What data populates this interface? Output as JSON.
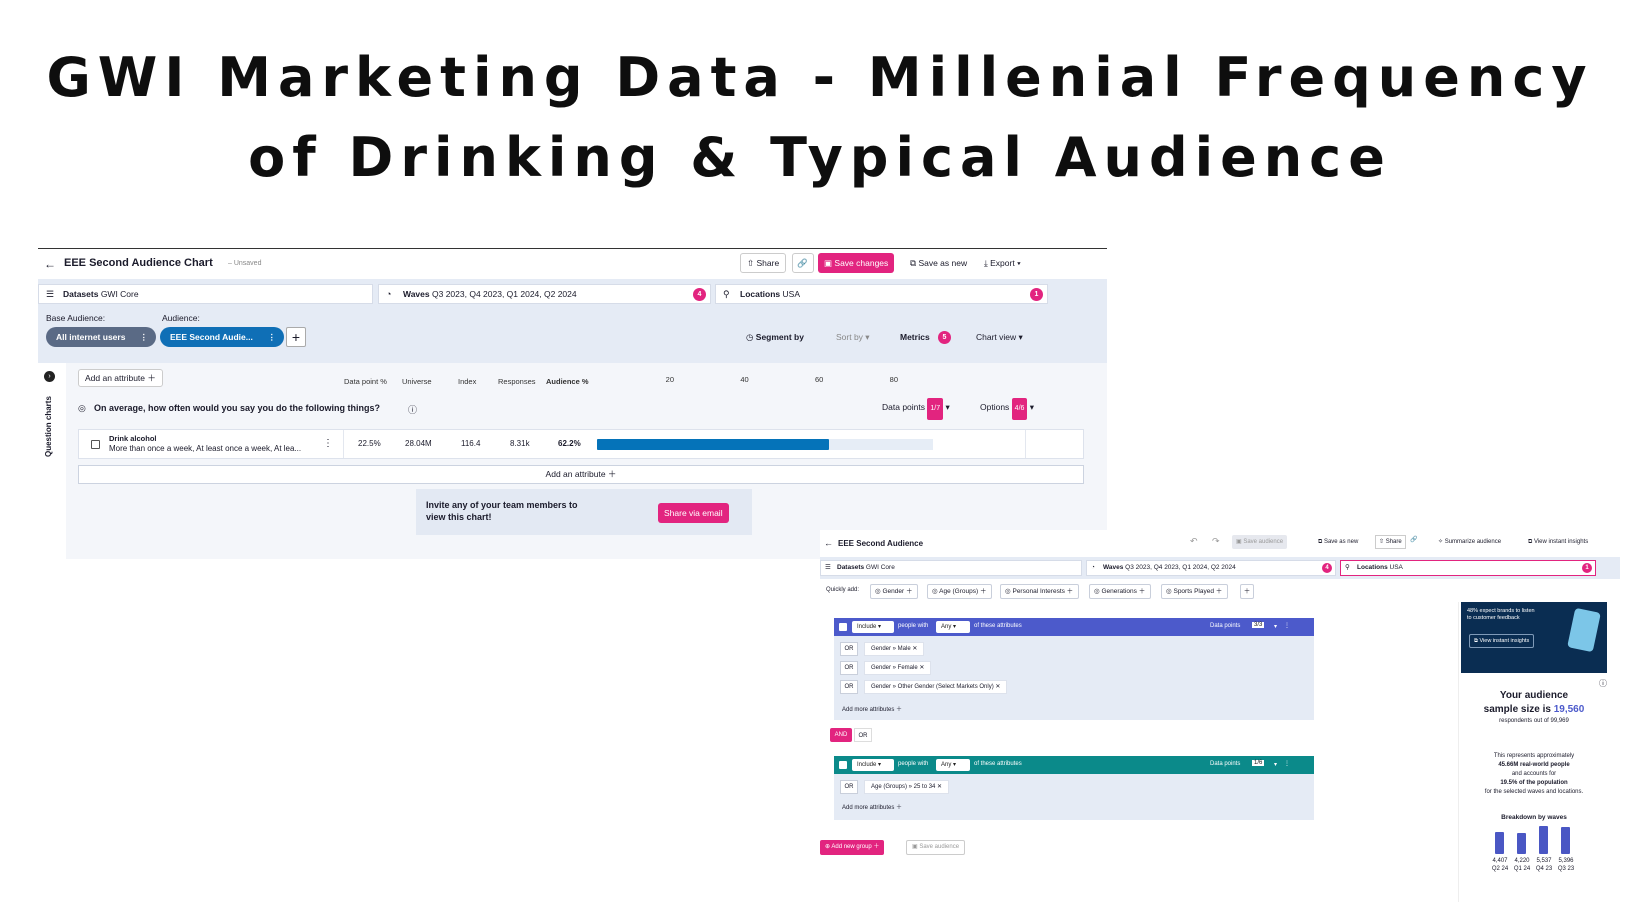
{
  "title_line1": "GWI Marketing Data - Millenial Frequency",
  "title_line2": "of Drinking & Typical Audience",
  "shot1": {
    "chart_title": "EEE Second Audience Chart",
    "unsaved": "– Unsaved",
    "share": "Share",
    "save_changes": "Save changes",
    "save_as_new": "Save as new",
    "export": "Export",
    "datasets_label": "Datasets",
    "datasets_value": "GWI Core",
    "waves_label": "Waves",
    "waves_value": "Q3 2023, Q4 2023, Q1 2024, Q2 2024",
    "waves_count": "4",
    "locations_label": "Locations",
    "locations_value": "USA",
    "locations_count": "1",
    "base_audience_label": "Base Audience:",
    "audience_label": "Audience:",
    "base_pill": "All internet users",
    "audience_pill": "EEE Second Audie...",
    "segment_by": "Segment by",
    "sort_by": "Sort by",
    "metrics": "Metrics",
    "metrics_count": "5",
    "chart_view": "Chart view",
    "question_charts": "Question charts",
    "add_attribute": "Add an attribute",
    "columns": [
      "Data point %",
      "Universe",
      "Index",
      "Responses",
      "Audience %"
    ],
    "axis_ticks": [
      "20",
      "40",
      "60",
      "80"
    ],
    "question": "On average, how often would you say you do the following things?",
    "data_points_label": "Data points",
    "data_points_value": "1/7",
    "options_label": "Options",
    "options_value": "4/6",
    "row": {
      "name": "Drink alcohol",
      "detail": "More than once a week, At least once a week, At lea...",
      "data_point_pct": "22.5%",
      "universe": "28.04M",
      "index": "116.4",
      "responses": "8.31k",
      "audience_pct": "62.2%"
    },
    "invite_text": "Invite any of your team members to view this chart!",
    "share_email": "Share via email"
  },
  "chart_data": {
    "type": "bar",
    "categories": [
      "Drink alcohol"
    ],
    "values": [
      62.2
    ],
    "xlim": [
      0,
      90
    ],
    "ticks": [
      20,
      40,
      60,
      80
    ]
  },
  "shot2": {
    "title": "EEE Second Audience",
    "save_audience": "Save audience",
    "save_as_new": "Save as new",
    "share": "Share",
    "summarize": "Summarize audience",
    "view_insights": "View instant insights",
    "datasets_label": "Datasets",
    "datasets_value": "GWI Core",
    "waves_label": "Waves",
    "waves_value": "Q3 2023, Q4 2023, Q1 2024, Q2 2024",
    "waves_count": "4",
    "locations_label": "Locations",
    "locations_value": "USA",
    "locations_count": "1",
    "quickly_add": "Quickly add:",
    "chips": [
      "Gender",
      "Age (Groups)",
      "Personal Interests",
      "Generations",
      "Sports Played"
    ],
    "include": "Include",
    "people_with": "people with",
    "any": "Any",
    "of_these": "of these attributes",
    "data_points": "Data points",
    "group1_dp": "3/3",
    "group1_items": [
      "Gender » Male",
      "Gender » Female",
      "Gender » Other Gender (Select Markets Only)"
    ],
    "or": "OR",
    "and": "AND",
    "add_more": "Add more attributes",
    "group2_dp": "1/6",
    "group2_items": [
      "Age (Groups) » 25 to 34"
    ],
    "add_group": "Add new group",
    "promo_text": "48% expect brands to listen to customer feedback",
    "promo_btn": "View instant insights",
    "your_audience": "Your audience",
    "sample_size_label": "sample size is",
    "sample_size": "19,560",
    "respondents": "respondents out of 99,969",
    "represents": "This represents approximately",
    "real_world": "45.66M real-world people",
    "accounts_for": "and accounts for",
    "population": "19.5% of the population",
    "selected": "for the selected waves and locations.",
    "breakdown": "Breakdown by waves",
    "waves": [
      {
        "value": "4,407",
        "label": "Q2 24",
        "n": 4407
      },
      {
        "value": "4,220",
        "label": "Q1 24",
        "n": 4220
      },
      {
        "value": "5,537",
        "label": "Q4 23",
        "n": 5537
      },
      {
        "value": "5,396",
        "label": "Q3 23",
        "n": 5396
      }
    ]
  }
}
